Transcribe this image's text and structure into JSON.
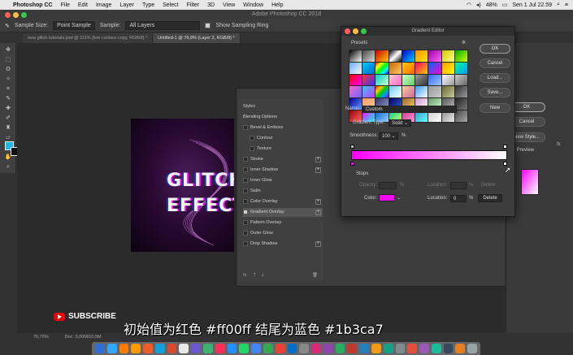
{
  "menubar": {
    "app_name": "Photoshop CC",
    "items": [
      "File",
      "Edit",
      "Image",
      "Layer",
      "Type",
      "Select",
      "Filter",
      "3D",
      "View",
      "Window",
      "Help"
    ],
    "battery": "48%",
    "datetime": "Sen 1 Jul  22.59"
  },
  "app": {
    "title": "Adobe Photoshop CC 2018"
  },
  "options": {
    "sample_size_label": "Sample Size:",
    "sample_size_value": "Point Sample",
    "sample_label": "Sample:",
    "sample_value": "All Layers",
    "show_ring_label": "Show Sampling Ring",
    "show_ring_checked": true
  },
  "doctabs": [
    {
      "label": "new glitch tutorials.psd @ 111% (line contour copy, RGB/8) *",
      "active": false
    },
    {
      "label": "Untitled-1 @ 76,8% (Layer 2, RGB/8) *",
      "active": true
    }
  ],
  "artwork": {
    "line1": "GLITCH",
    "line2": "EFFECT"
  },
  "layer_style": {
    "items": [
      {
        "label": "Styles",
        "checkbox": false,
        "plus": false,
        "selected": false
      },
      {
        "label": "Blending Options",
        "checkbox": false,
        "plus": false,
        "selected": false
      },
      {
        "label": "Bevel & Emboss",
        "checkbox": true,
        "checked": false,
        "plus": false,
        "selected": false
      },
      {
        "label": "Contour",
        "checkbox": true,
        "checked": false,
        "plus": false,
        "selected": false,
        "indent": true
      },
      {
        "label": "Texture",
        "checkbox": true,
        "checked": false,
        "plus": false,
        "selected": false,
        "indent": true
      },
      {
        "label": "Stroke",
        "checkbox": true,
        "checked": false,
        "plus": true,
        "selected": false
      },
      {
        "label": "Inner Shadow",
        "checkbox": true,
        "checked": false,
        "plus": true,
        "selected": false
      },
      {
        "label": "Inner Glow",
        "checkbox": true,
        "checked": false,
        "plus": false,
        "selected": false
      },
      {
        "label": "Satin",
        "checkbox": true,
        "checked": false,
        "plus": false,
        "selected": false
      },
      {
        "label": "Color Overlay",
        "checkbox": true,
        "checked": false,
        "plus": true,
        "selected": false
      },
      {
        "label": "Gradient Overlay",
        "checkbox": true,
        "checked": true,
        "plus": true,
        "selected": true
      },
      {
        "label": "Pattern Overlay",
        "checkbox": true,
        "checked": false,
        "plus": false,
        "selected": false
      },
      {
        "label": "Outer Glow",
        "checkbox": true,
        "checked": false,
        "plus": false,
        "selected": false
      },
      {
        "label": "Drop Shadow",
        "checkbox": true,
        "checked": false,
        "plus": true,
        "selected": false
      }
    ],
    "fx_label": "fx"
  },
  "gradient_editor": {
    "title": "Gradient Editor",
    "presets_label": "Presets",
    "buttons": {
      "ok": "OK",
      "cancel": "Cancel",
      "load": "Load...",
      "save": "Save...",
      "new": "New"
    },
    "name_label": "Name:",
    "name_value": "Custom",
    "type_label": "Gradient Type:",
    "type_value": "Solid",
    "smoothness_label": "Smoothness:",
    "smoothness_value": "100",
    "smoothness_unit": "%",
    "stops_label": "Stops",
    "opacity_label": "Opacity:",
    "opacity_unit": "%",
    "location_label": "Location:",
    "location_unit": "%",
    "location_value": "0",
    "delete_label": "Delete",
    "color_label": "Color:",
    "start_color": "#ff00ff",
    "end_color": "#ffffff"
  },
  "right_panel": {
    "ok": "OK",
    "cancel": "Cancel",
    "new_style": "New Style...",
    "preview": "Preview"
  },
  "status": {
    "zoom": "76,76%",
    "doc": "Doc: 3,00M/10,5M"
  },
  "subscribe": "SUBSCRIBE",
  "subtitle": "初始值为红色 #ff00ff 结尾为蓝色 #1b3ca7",
  "colors": {
    "foreground": "#19b8e6",
    "background": "#111111",
    "accent_magenta": "#ff00ff",
    "accent_blue": "#1b3ca7"
  }
}
